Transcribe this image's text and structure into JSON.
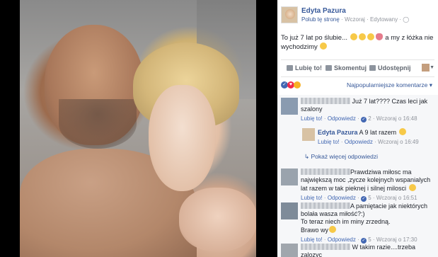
{
  "post": {
    "author": "Edyta Pazura",
    "like_page": "Polub tę stronę",
    "time": "Wczoraj",
    "edited": "Edytowany",
    "text_part1": "To już 7 lat po ślubie...",
    "text_part2": "a my z łóżka nie wychodzimy"
  },
  "actions": {
    "like": "Lubię to!",
    "comment": "Skomentuj",
    "share": "Udostępnij"
  },
  "sort_label": "Najpopularniejsze komentarze",
  "comments": [
    {
      "text": "Już 7 lat???? Czas leci jak szalony",
      "like": "Lubię to!",
      "reply": "Odpowiedz",
      "count": "2",
      "time": "Wczoraj o 16:48"
    },
    {
      "author": "Edyta Pazura",
      "text": "A 9 lat razem",
      "like": "Lubię to!",
      "reply": "Odpowiedz",
      "time": "Wczoraj o 16:49"
    },
    {
      "text": "Prawdziwa miłosc ma największą moc ,zycze kolejnych wspanialych lat razem w tak pieknej i silnej milosci",
      "like": "Lubię to!",
      "reply": "Odpowiedz",
      "count": "5",
      "time": "Wczoraj o 16:51"
    },
    {
      "text_line1": "A pamiętacie jak niektórych bolała wasza miłość?:)",
      "text_line2": "To teraz niech im miny zrzedną.",
      "text_line3": "Brawo wy",
      "like": "Lubię to!",
      "reply": "Odpowiedz",
      "count": "5",
      "time": "Wczoraj o 17:30"
    },
    {
      "text": "W takim razie....trzeba zalozyc"
    }
  ],
  "more_replies": "Pokaż więcej odpowiedzi",
  "colors": {
    "link": "#365899",
    "like_blue": "#4267b2",
    "muted": "#90949c"
  }
}
